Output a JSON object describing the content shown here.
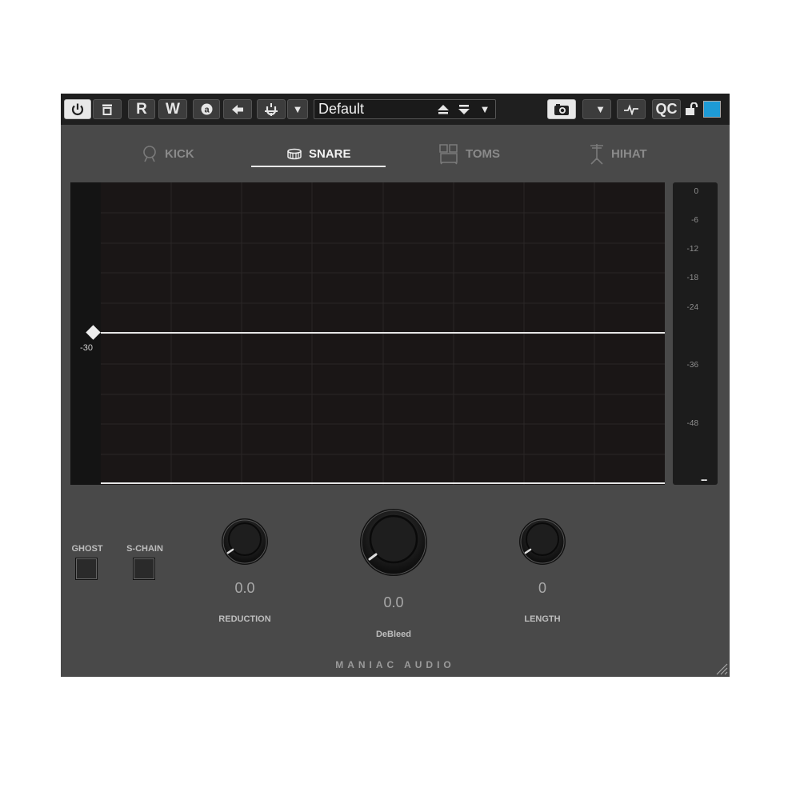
{
  "toolbar": {
    "read_label": "R",
    "write_label": "W",
    "preset_name": "Default",
    "qc_label": "QC",
    "swatch_color": "#1e9bd6"
  },
  "tabs": [
    {
      "label": "KICK",
      "icon": "kick-drum-icon",
      "active": false
    },
    {
      "label": "SNARE",
      "icon": "snare-drum-icon",
      "active": true
    },
    {
      "label": "TOMS",
      "icon": "toms-icon",
      "active": false
    },
    {
      "label": "HIHAT",
      "icon": "hihat-icon",
      "active": false
    }
  ],
  "graph": {
    "threshold_db": -30,
    "threshold_label": "-30"
  },
  "meter": {
    "ticks": [
      "0",
      "-6",
      "-12",
      "-18",
      "-24",
      "-36",
      "-48"
    ],
    "readout": "--"
  },
  "buttons": {
    "ghost_label": "GHOST",
    "schain_label": "S-CHAIN"
  },
  "knobs": {
    "reduction": {
      "label": "REDUCTION",
      "value": "0.0"
    },
    "debleed": {
      "label": "DeBleed",
      "value": "0.0"
    },
    "length": {
      "label": "LENGTH",
      "value": "0"
    }
  },
  "brand": "MANIAC AUDIO"
}
